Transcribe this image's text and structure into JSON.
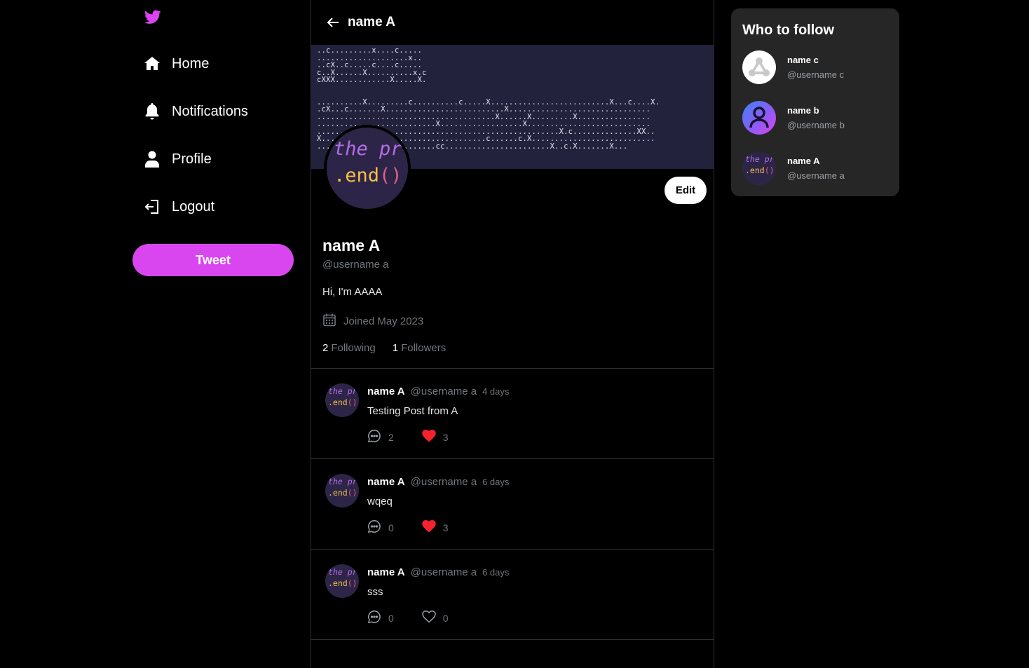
{
  "sidebar": {
    "nav": [
      {
        "label": "Home"
      },
      {
        "label": "Notifications"
      },
      {
        "label": "Profile"
      },
      {
        "label": "Logout"
      }
    ],
    "tweet_button": "Tweet"
  },
  "header": {
    "title": "name A"
  },
  "banner": {
    "ascii": "..c.........x....c.....\n....................x..\n..cX..c.....c....c.....\nc..X......X..........x.c\ncXXX............X.....X.\n\n\n..........X.........c..........c.....X..........................X...c....X.\n.cX...c.......X..........................X...............................\n.......................................X......X.........X................\n..........................X..................X...........................\n.....................................................X.c..............XX..\nX....................................c......c.X...........................\n..........................cc.......................X..c.X.......X..."
  },
  "profile": {
    "avatar_text_top": "the pr",
    "avatar_text_bottom": ".end",
    "avatar_parens": "()",
    "avatar_comma": ",",
    "edit_label": "Edit",
    "name": "name A",
    "handle": "@username a",
    "bio": "Hi, I'm AAAA",
    "joined": "Joined May 2023",
    "following_count": "2",
    "following_label": "Following",
    "followers_count": "1",
    "followers_label": "Followers"
  },
  "tweets": [
    {
      "name": "name A",
      "handle": "@username a",
      "time": "4 days",
      "text": "Testing Post from A",
      "comments": "2",
      "likes": "3",
      "liked": true
    },
    {
      "name": "name A",
      "handle": "@username a",
      "time": "6 days",
      "text": "wqeq",
      "comments": "0",
      "likes": "3",
      "liked": true
    },
    {
      "name": "name A",
      "handle": "@username a",
      "time": "6 days",
      "text": "sss",
      "comments": "0",
      "likes": "0",
      "liked": false
    }
  ],
  "who_to_follow": {
    "title": "Who to follow",
    "users": [
      {
        "name": "name c",
        "handle": "@username c",
        "avatar": "default-avatar-icon"
      },
      {
        "name": "name b",
        "handle": "@username b",
        "avatar": "person-gradient-icon"
      },
      {
        "name": "name A",
        "handle": "@username a",
        "avatar": "code-avatar"
      }
    ]
  },
  "colors": {
    "accent": "#d946ef",
    "like": "#f4212e",
    "banner_bg": "#22223d",
    "panel_bg": "#262626"
  }
}
